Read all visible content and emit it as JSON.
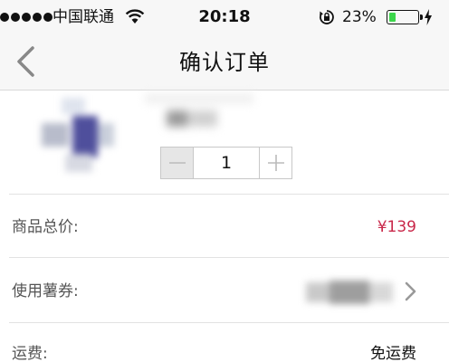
{
  "status_bar": {
    "carrier": "中国联通",
    "time": "20:18",
    "battery_percent": "23%",
    "battery_level": 0.23,
    "icons": [
      "signal-dots-icon",
      "wifi-icon",
      "rotation-lock-icon",
      "battery-icon",
      "charging-bolt-icon"
    ],
    "battery_color": "#3cd64b"
  },
  "nav": {
    "title": "确认订单",
    "back_icon": "chevron-left-icon"
  },
  "product": {
    "quantity": "1",
    "decrement_icon": "minus-icon",
    "increment_icon": "plus-icon"
  },
  "rows": {
    "total": {
      "label": "商品总价:",
      "value": "¥139",
      "color": "#c9284a"
    },
    "coupon": {
      "label": "使用薯券:",
      "arrow_icon": "chevron-right-icon"
    },
    "shipping": {
      "label": "运费:",
      "value": "免运费"
    }
  }
}
